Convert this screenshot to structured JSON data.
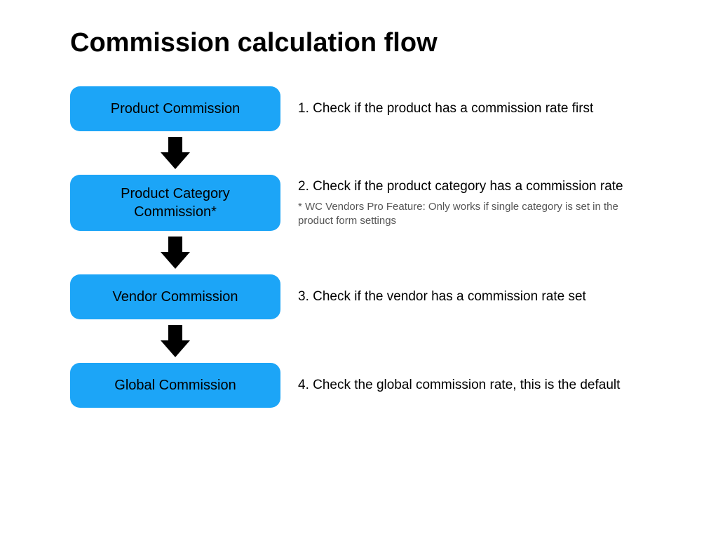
{
  "title": "Commission calculation flow",
  "colors": {
    "box_bg": "#1ca5f7",
    "arrow": "#000000"
  },
  "steps": [
    {
      "label": "Product Commission",
      "description": "1. Check if the product has a commission rate first",
      "note": null
    },
    {
      "label": "Product Category Commission*",
      "description": "2. Check if the product category has a commission rate",
      "note": "* WC Vendors Pro Feature: Only works if single category is set in the product form settings"
    },
    {
      "label": "Vendor Commission",
      "description": "3. Check if the vendor has a commission rate set",
      "note": null
    },
    {
      "label": "Global Commission",
      "description": "4. Check the global commission rate, this is the default",
      "note": null
    }
  ]
}
